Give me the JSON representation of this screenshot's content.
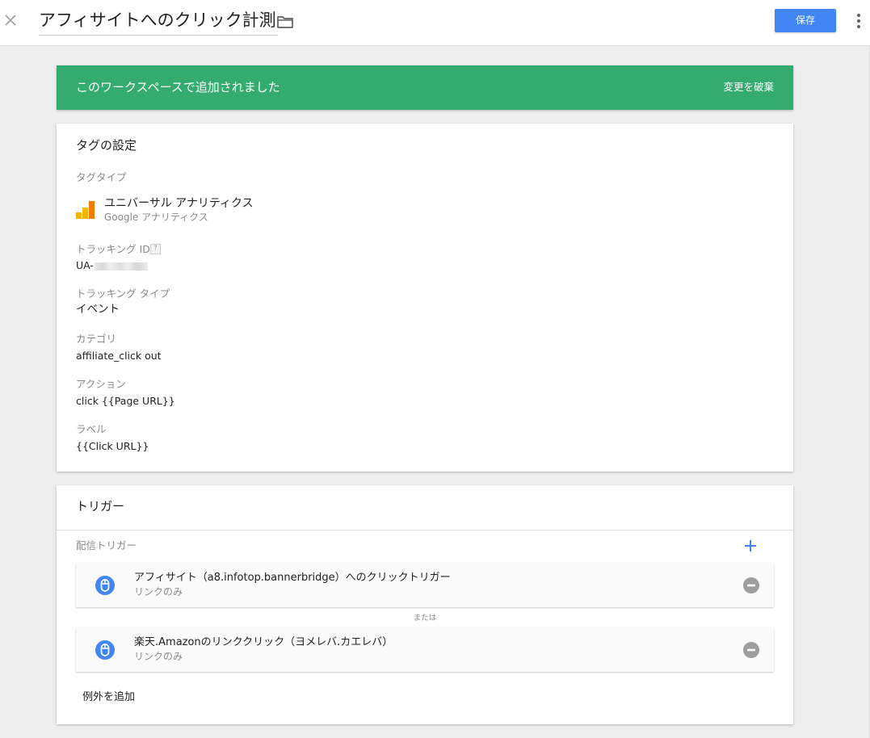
{
  "header": {
    "title": "アフィサイトへのクリック計測",
    "save_label": "保存",
    "close_icon": "close-icon",
    "folder_icon": "folder-icon",
    "more_icon": "more-vert-icon",
    "accent_color": "#4285f4"
  },
  "banner": {
    "text": "このワークスペースで追加されました",
    "discard_label": "変更を破棄",
    "color": "#34ab6f"
  },
  "tag_config": {
    "title": "タグの設定",
    "tag_type_label": "タグタイプ",
    "tag_type_name": "ユニバーサル アナリティクス",
    "tag_type_vendor": "Google アナリティクス",
    "tag_type_icon": "google-analytics-icon",
    "tracking_id_label": "トラッキング ID",
    "tracking_id_help": "?",
    "tracking_id_value": "UA-",
    "tracking_type_label": "トラッキング タイプ",
    "tracking_type_value": "イベント",
    "category_label": "カテゴリ",
    "category_value": "affiliate_click out",
    "action_label": "アクション",
    "action_value": "click {{Page URL}}",
    "label_label": "ラベル",
    "label_value": "{{Click URL}}"
  },
  "triggers": {
    "title": "トリガー",
    "firing_label": "配信トリガー",
    "add_icon": "plus-icon",
    "or_label": "または",
    "add_exception_label": "例外を追加",
    "items": [
      {
        "name": "アフィサイト（a8.infotop.bannerbridge）へのクリックトリガー",
        "type": "リンクのみ",
        "icon": "mouse-click-icon"
      },
      {
        "name": "楽天.Amazonのリンククリック（ヨメレバ.カエレバ）",
        "type": "リンクのみ",
        "icon": "mouse-click-icon"
      }
    ]
  }
}
